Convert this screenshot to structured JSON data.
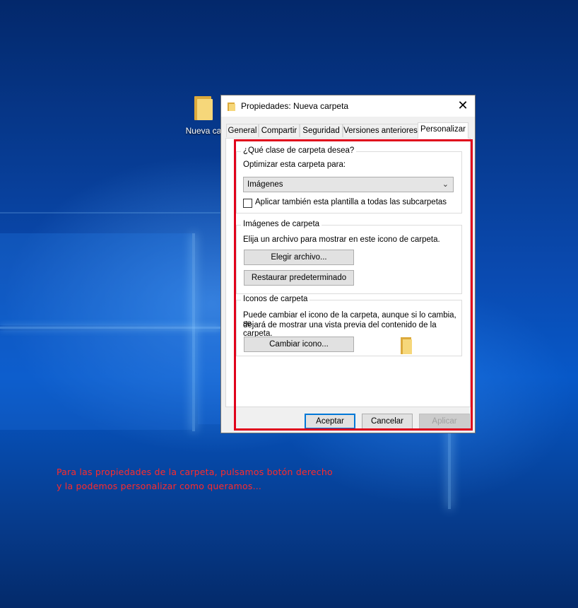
{
  "desktop": {
    "icon_label": "Nueva ca"
  },
  "dialog": {
    "title": "Propiedades: Nueva carpeta",
    "close_symbol": "✕",
    "tabs": [
      {
        "label": "General",
        "active": false
      },
      {
        "label": "Compartir",
        "active": false
      },
      {
        "label": "Seguridad",
        "active": false
      },
      {
        "label": "Versiones anteriores",
        "active": false
      },
      {
        "label": "Personalizar",
        "active": true
      }
    ],
    "folder_type_group": {
      "legend": "¿Qué clase de carpeta desea?",
      "optimize_label": "Optimizar esta carpeta para:",
      "optimize_value": "Imágenes",
      "apply_subfolders_label": "Aplicar también esta plantilla a todas las subcarpetas",
      "apply_subfolders_checked": false
    },
    "folder_pictures_group": {
      "legend": "Imágenes de carpeta",
      "description": "Elija un archivo para mostrar en este icono de carpeta.",
      "choose_file_button": "Elegir archivo...",
      "restore_default_button": "Restaurar predeterminado"
    },
    "folder_icons_group": {
      "legend": "Iconos de carpeta",
      "description_line1": "Puede cambiar el icono de la carpeta, aunque si lo cambia, se",
      "description_line2": "dejará de mostrar una vista previa del contenido de la carpeta.",
      "change_icon_button": "Cambiar icono..."
    },
    "footer": {
      "ok_button": "Aceptar",
      "cancel_button": "Cancelar",
      "apply_button": "Aplicar"
    }
  },
  "annotation": {
    "line1": "Para las propiedades de la carpeta, pulsamos botón derecho",
    "line2": "y la podemos personalizar como queramos...",
    "color": "#ff2a2a"
  },
  "colors": {
    "highlight_border": "#e0001b",
    "default_button_border": "#0078d7",
    "folder_yellow": "#f6d77a"
  }
}
